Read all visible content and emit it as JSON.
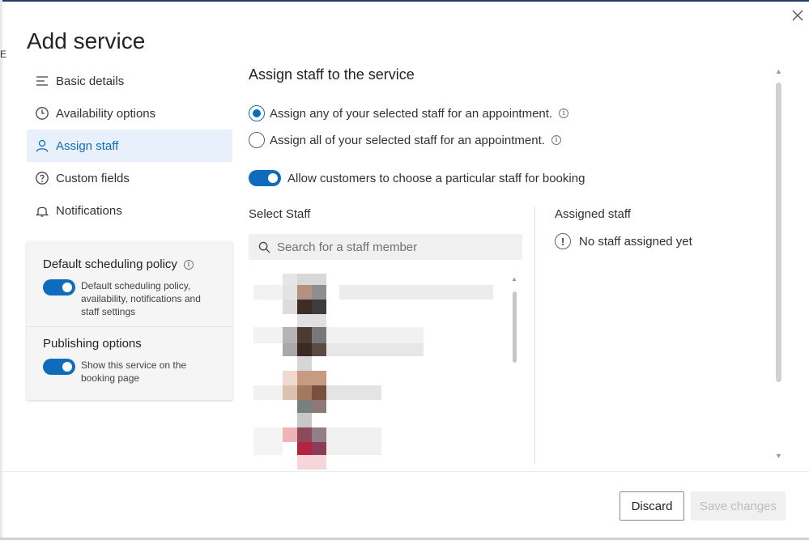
{
  "dialog": {
    "title": "Add service",
    "close_icon": "close-icon"
  },
  "background_peek_letter": "E",
  "nav": {
    "items": [
      {
        "label": "Basic details",
        "icon": "list-lines-icon",
        "active": false
      },
      {
        "label": "Availability options",
        "icon": "clock-icon",
        "active": false
      },
      {
        "label": "Assign staff",
        "icon": "person-icon",
        "active": true
      },
      {
        "label": "Custom fields",
        "icon": "question-circle-icon",
        "active": false
      },
      {
        "label": "Notifications",
        "icon": "bell-icon",
        "active": false
      }
    ]
  },
  "policy": {
    "default_title": "Default scheduling policy",
    "default_desc": "Default scheduling policy, availability, notifications and staff settings",
    "default_on": true,
    "publishing_title": "Publishing options",
    "publishing_desc": "Show this service on the booking page",
    "publishing_on": true
  },
  "assign": {
    "title": "Assign staff to the service",
    "option_any": "Assign any of your selected staff for an appointment.",
    "option_all": "Assign all of your selected staff for an appointment.",
    "selected_option": "any",
    "allow_choose": "Allow customers to choose a particular staff for booking",
    "allow_choose_on": true,
    "select_staff_label": "Select Staff",
    "search_placeholder": "Search for a staff member",
    "assigned_label": "Assigned staff",
    "no_staff": "No staff assigned yet"
  },
  "footer": {
    "discard": "Discard",
    "save": "Save changes"
  },
  "colors": {
    "accent": "#0f6cbd",
    "active_nav_bg": "#e8f0fb",
    "top_bar": "#1f3f66"
  }
}
